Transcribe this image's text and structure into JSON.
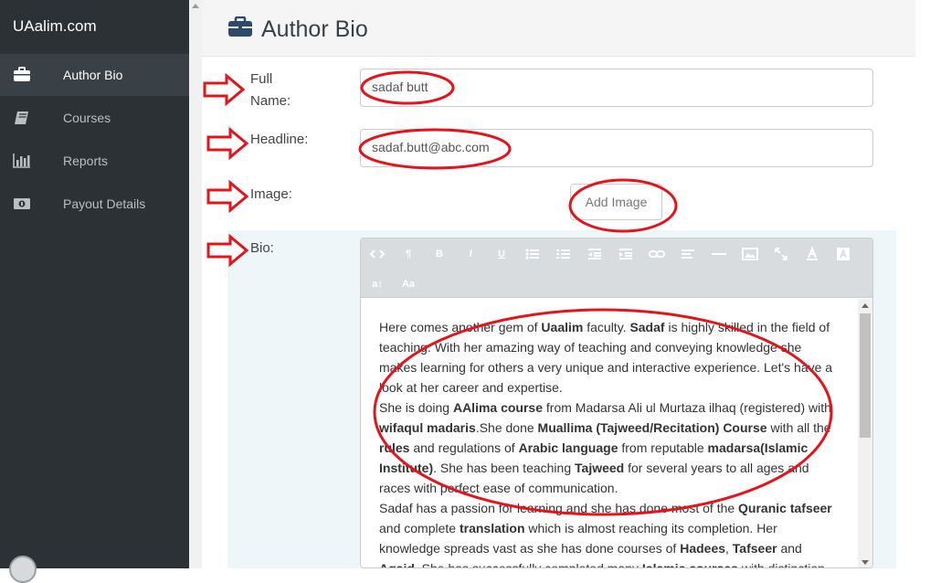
{
  "app": {
    "brand": "UAalim.com"
  },
  "sidebar": {
    "items": [
      {
        "label": "Author Bio",
        "icon": "briefcase-icon",
        "active": true
      },
      {
        "label": "Courses",
        "icon": "book-icon",
        "active": false
      },
      {
        "label": "Reports",
        "icon": "bar-chart-icon",
        "active": false
      },
      {
        "label": "Payout Details",
        "icon": "money-icon",
        "active": false
      }
    ]
  },
  "header": {
    "title": "Author Bio",
    "icon": "briefcase-icon"
  },
  "form": {
    "full_name": {
      "label_line1": "Full",
      "label_line2": "Name:",
      "value": "sadaf butt"
    },
    "headline": {
      "label": "Headline:",
      "value": "sadaf.butt@abc.com"
    },
    "image": {
      "label": "Image:",
      "button": "Add Image"
    },
    "bio": {
      "label": "Bio:",
      "toolbar": [
        "code-icon",
        "paragraph-icon",
        "bold-icon",
        "italic-icon",
        "underline-icon",
        "unordered-list-icon",
        "ordered-list-icon",
        "outdent-icon",
        "indent-icon",
        "link-icon",
        "align-icon",
        "horizontal-rule-icon",
        "image-icon",
        "fullscreen-icon",
        "font-color-icon",
        "background-color-icon",
        "line-height-icon",
        "font-size-icon"
      ],
      "toolbar_text": {
        "bold": "B",
        "italic": "I",
        "underline": "U",
        "font_size": "Aa",
        "line_height": "a↕",
        "paragraph": "¶"
      },
      "text_segments": [
        "Here comes another gem of ",
        "Uaalim",
        " faculty. ",
        "Sadaf",
        " is highly skilled in the field of teaching. With her amazing way of teaching and conveying knowledge she makes learning for others a very unique and interactive experience. Let's have a look at her career and expertise.",
        "She is doing ",
        "AAlima course",
        " from Madarsa Ali ul Murtaza ilhaq (registered) with ",
        "wifaqul madaris",
        ".She done ",
        "Muallima (Tajweed/Recitation) Course",
        " with all the ",
        "rules",
        " and regulations of ",
        "Arabic language",
        " from reputable ",
        "madarsa(Islamic Institute)",
        ". She has been teaching ",
        "Tajweed",
        " for several years to all ages and races with perfect ease of communication.",
        "Sadaf has a passion for learning and she has done most of the ",
        "Quranic tafseer",
        " and complete ",
        "translation",
        " which is almost reaching its completion. Her knowledge spreads vast as she has done courses of ",
        "Hadees",
        ", ",
        "Tafseer",
        " and ",
        "Aqaid",
        ". She has successfully completed many ",
        "Islamic courses",
        " with distinction"
      ]
    }
  },
  "annotation_colors": {
    "arrow": "#e3141b",
    "ellipse": "#e3141b"
  }
}
